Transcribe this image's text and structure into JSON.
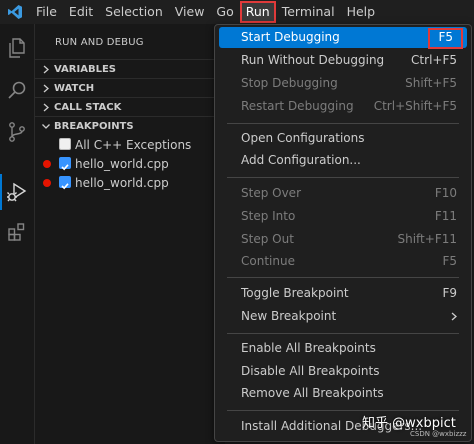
{
  "menubar": {
    "items": [
      "File",
      "Edit",
      "Selection",
      "View",
      "Go",
      "Run",
      "Terminal",
      "Help"
    ],
    "active": "Run"
  },
  "sidebar": {
    "title": "RUN AND DEBUG",
    "sections": [
      "VARIABLES",
      "WATCH",
      "CALL STACK",
      "BREAKPOINTS"
    ],
    "breakpoints": [
      {
        "label": "All C++ Exceptions",
        "checked": false,
        "has_dot": false
      },
      {
        "label": "hello_world.cpp",
        "checked": true,
        "has_dot": true
      },
      {
        "label": "hello_world.cpp",
        "checked": true,
        "has_dot": true
      }
    ]
  },
  "run_menu": {
    "items": [
      {
        "label": "Start Debugging",
        "key": "F5",
        "state": "highlight"
      },
      {
        "label": "Run Without Debugging",
        "key": "Ctrl+F5",
        "state": "enabled"
      },
      {
        "label": "Stop Debugging",
        "key": "Shift+F5",
        "state": "disabled"
      },
      {
        "label": "Restart Debugging",
        "key": "Ctrl+Shift+F5",
        "state": "disabled"
      },
      {
        "label": "Open Configurations",
        "key": "",
        "state": "enabled"
      },
      {
        "label": "Add Configuration...",
        "key": "",
        "state": "enabled"
      },
      {
        "label": "Step Over",
        "key": "F10",
        "state": "disabled"
      },
      {
        "label": "Step Into",
        "key": "F11",
        "state": "disabled"
      },
      {
        "label": "Step Out",
        "key": "Shift+F11",
        "state": "disabled"
      },
      {
        "label": "Continue",
        "key": "F5",
        "state": "disabled"
      },
      {
        "label": "Toggle Breakpoint",
        "key": "F9",
        "state": "enabled"
      },
      {
        "label": "New Breakpoint",
        "key": "",
        "state": "enabled"
      },
      {
        "label": "Enable All Breakpoints",
        "key": "",
        "state": "enabled"
      },
      {
        "label": "Disable All Breakpoints",
        "key": "",
        "state": "enabled"
      },
      {
        "label": "Remove All Breakpoints",
        "key": "",
        "state": "enabled"
      },
      {
        "label": "Install Additional Debuggers...",
        "key": "",
        "state": "enabled"
      }
    ]
  },
  "watermark": {
    "main": "知乎 @wxbpict",
    "small": "CSDN @wxbizzz"
  },
  "colors": {
    "accent": "#0078d4",
    "highlight_box": "#e03a3a",
    "breakpoint": "#e51400"
  }
}
